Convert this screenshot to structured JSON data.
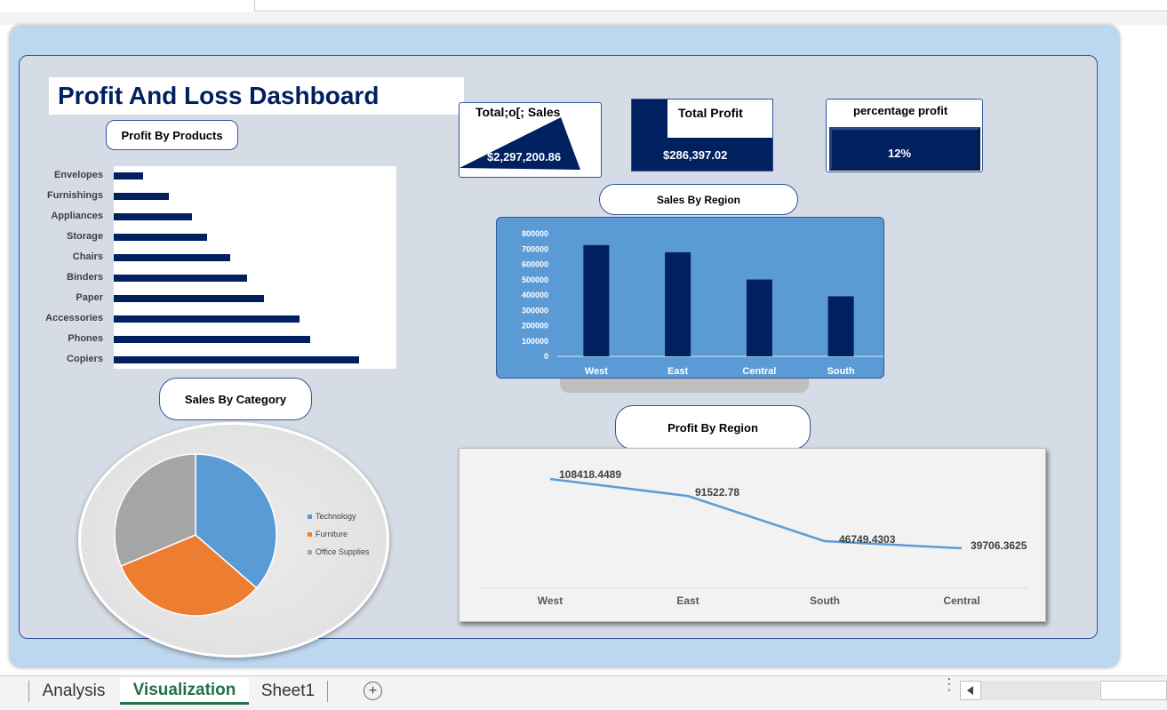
{
  "dashboard": {
    "title": "Profit And Loss Dashboard",
    "profit_by_products_title": "Profit By Products",
    "sales_by_category_title": "Sales By Category",
    "sales_by_region_title": "Sales By Region",
    "profit_by_region_title": "Profit By Region"
  },
  "kpis": {
    "total_sales": {
      "label": "Total;o[; Sales",
      "value": "$2,297,200.86"
    },
    "total_profit": {
      "label": "Total Profit",
      "value": "$286,397.02"
    },
    "percentage_profit": {
      "label": "percentage profit",
      "value": "12%"
    }
  },
  "colors": {
    "navy": "#002060",
    "blue": "#5b9bd5",
    "orange": "#ed7d31",
    "gray": "#a5a5a5"
  },
  "chart_data": [
    {
      "type": "bar",
      "orientation": "horizontal",
      "categories": [
        "Envelopes",
        "Furnishings",
        "Appliances",
        "Storage",
        "Chairs",
        "Binders",
        "Paper",
        "Accessories",
        "Phones",
        "Copiers"
      ],
      "values": [
        7000,
        13000,
        18500,
        22000,
        27500,
        31500,
        35500,
        44000,
        46500,
        58000
      ],
      "xlim": [
        0,
        62000
      ]
    },
    {
      "type": "bar",
      "categories": [
        "West",
        "East",
        "Central",
        "South"
      ],
      "values": [
        725458,
        678781,
        501239,
        391721
      ],
      "ylim": [
        0,
        800000
      ],
      "yticks": [
        "800000",
        "700000",
        "600000",
        "500000",
        "400000",
        "300000",
        "200000",
        "100000",
        "0"
      ]
    },
    {
      "type": "pie",
      "legend_placement": "right",
      "series": [
        {
          "name": "Technology",
          "value": 36.4
        },
        {
          "name": "Furniture",
          "value": 32.3
        },
        {
          "name": "Office Supplies",
          "value": 31.3
        }
      ]
    },
    {
      "type": "line",
      "categories": [
        "West",
        "East",
        "South",
        "Central"
      ],
      "values": [
        108418.4489,
        91522.78,
        46749.4303,
        39706.3625
      ],
      "labels": [
        "108418.4489",
        "91522.78",
        "46749.4303",
        "39706.3625"
      ]
    }
  ],
  "sheet_tabs": [
    "Analysis",
    "Visualization",
    "Sheet1"
  ],
  "active_tab": "Visualization",
  "add_sheet_symbol": "+"
}
